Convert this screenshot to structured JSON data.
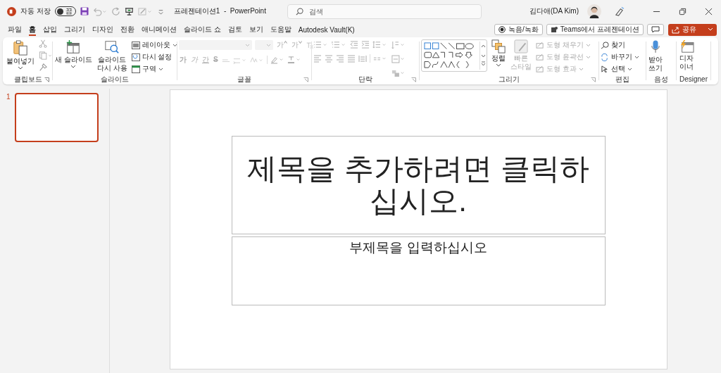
{
  "title_bar": {
    "autosave_label": "자동 저장",
    "autosave": {
      "on": false,
      "label": "끔"
    },
    "document_title": "프레젠테이션1  -  PowerPoint",
    "search": {
      "placeholder": "검색"
    },
    "user": "김다애(DA Kim)"
  },
  "tabs": [
    {
      "label": "파일",
      "selected": false
    },
    {
      "label": "홈",
      "selected": true
    },
    {
      "label": "삽입",
      "selected": false
    },
    {
      "label": "그리기",
      "selected": false
    },
    {
      "label": "디자인",
      "selected": false
    },
    {
      "label": "전환",
      "selected": false
    },
    {
      "label": "애니메이션",
      "selected": false
    },
    {
      "label": "슬라이드 쇼",
      "selected": false
    },
    {
      "label": "검토",
      "selected": false
    },
    {
      "label": "보기",
      "selected": false
    },
    {
      "label": "도움말",
      "selected": false
    },
    {
      "label": "Autodesk Vault(K)",
      "selected": false
    }
  ],
  "tab_actions": {
    "record": "녹음/녹화",
    "teams": "Teams에서 프레젠테이션",
    "share": "공유"
  },
  "ribbon": {
    "clipboard": {
      "label": "클립보드",
      "paste": "붙여넣기"
    },
    "slides": {
      "label": "슬라이드",
      "new_slide": "새 슬라이드",
      "reuse": "슬라이드\n다시 사용",
      "small": [
        {
          "label": "레이아웃",
          "dropdown": true
        },
        {
          "label": "다시 설정",
          "dropdown": false
        },
        {
          "label": "구역",
          "dropdown": true
        }
      ]
    },
    "font": {
      "label": "글꼴",
      "size_buttons": [
        {
          "text": "가",
          "kind": "grow",
          "disabled": true
        },
        {
          "text": "가",
          "kind": "shrink",
          "disabled": true
        }
      ],
      "format_buttons": [
        {
          "text": "가",
          "kind": "bold",
          "disabled": true
        },
        {
          "text": "가",
          "kind": "italic",
          "disabled": true
        },
        {
          "text": "간",
          "kind": "underline",
          "disabled": true
        },
        {
          "text": "S",
          "kind": "strike",
          "disabled": true
        }
      ]
    },
    "paragraph": {
      "label": "단락"
    },
    "drawing": {
      "label": "그리기",
      "arrange": "정렬",
      "quick_styles": {
        "label": "빠른\n스타일",
        "disabled": true
      },
      "shape_options": [
        {
          "label": "도형 채우기",
          "disabled": true
        },
        {
          "label": "도형 윤곽선",
          "disabled": true
        },
        {
          "label": "도형 효과",
          "disabled": true
        }
      ]
    },
    "editing": {
      "label": "편집",
      "items": [
        {
          "label": "찾기",
          "dropdown": false
        },
        {
          "label": "바꾸기",
          "dropdown": true
        },
        {
          "label": "선택",
          "dropdown": true
        }
      ]
    },
    "voice": {
      "label": "음성",
      "dictate": "받아\n쓰기"
    },
    "designer": {
      "label": "Designer",
      "designer": "디자\n이너"
    }
  },
  "thumbnails": [
    {
      "number": "1",
      "selected": true
    }
  ],
  "slide": {
    "title_placeholder": "제목을 추가하려면 클릭하십시오.",
    "subtitle_placeholder": "부제목을 입력하십시오"
  }
}
